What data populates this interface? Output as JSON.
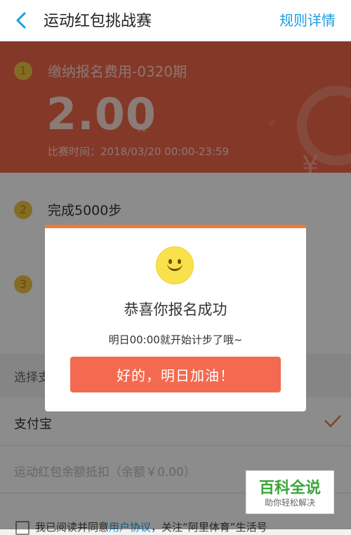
{
  "header": {
    "title": "运动红包挑战赛",
    "rules_label": "规则详情"
  },
  "banner": {
    "step_number": "1",
    "fee_title": "缴纳报名费用-0320期",
    "amount": "2.00",
    "amount_unit": "元",
    "time": "比赛时间：2018/03/20 00:00-23:59"
  },
  "steps": [
    {
      "number": "2",
      "label": "完成5000步"
    },
    {
      "number": "3"
    }
  ],
  "payment": {
    "section_label": "选择支",
    "alipay": "支付宝",
    "balance": "运动红包余额抵扣（余额￥0.00）",
    "agree_prefix": "我已阅读并同意",
    "agree_link": "用户协议",
    "agree_suffix": "，关注“阿里体育”生活号"
  },
  "modal": {
    "title": "恭喜你报名成功",
    "subtitle": "明日00:00就开始计步了哦~",
    "button": "好的，明日加油！"
  },
  "watermark": {
    "main": "百科全说",
    "sub": "助你轻松解决"
  },
  "colors": {
    "accent": "#f36a50",
    "banner": "#f0664a",
    "link": "#1a9de2",
    "modal_top": "#f07a3a"
  }
}
